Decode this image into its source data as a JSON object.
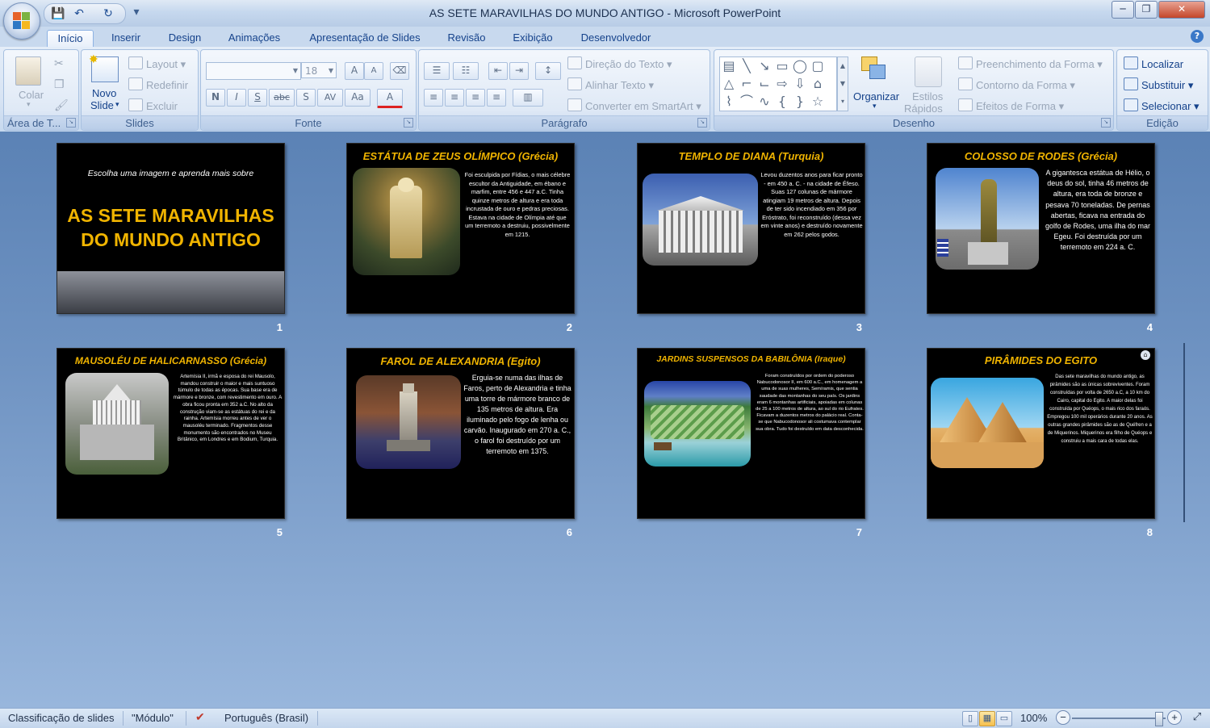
{
  "window": {
    "title": "AS SETE MARAVILHAS DO MUNDO ANTIGO - Microsoft PowerPoint",
    "minimize": "─",
    "maximize": "❐",
    "close": "✕"
  },
  "quick_access": {
    "save_icon": "save-icon",
    "undo_icon": "undo-icon",
    "redo_icon": "redo-icon",
    "customize_icon": "customize-qat-icon"
  },
  "tabs": [
    {
      "label": "Início",
      "active": true
    },
    {
      "label": "Inserir"
    },
    {
      "label": "Design"
    },
    {
      "label": "Animações"
    },
    {
      "label": "Apresentação de Slides"
    },
    {
      "label": "Revisão"
    },
    {
      "label": "Exibição"
    },
    {
      "label": "Desenvolvedor"
    }
  ],
  "ribbon": {
    "clipboard": {
      "label": "Área de T...",
      "paste": "Colar"
    },
    "slides": {
      "label": "Slides",
      "new_slide_1": "Novo",
      "new_slide_2": "Slide",
      "layout": "Layout",
      "reset": "Redefinir",
      "delete": "Excluir"
    },
    "font": {
      "label": "Fonte",
      "font_name": "",
      "font_size": "18",
      "bold": "N",
      "italic": "I",
      "underline": "S",
      "strike": "abc",
      "shadow": "S",
      "spacing": "AV",
      "case": "Aa",
      "color": "A",
      "grow": "A",
      "shrink": "A"
    },
    "paragraph": {
      "label": "Parágrafo",
      "text_direction": "Direção do Texto",
      "align_text": "Alinhar Texto",
      "smartart": "Converter em SmartArt"
    },
    "drawing": {
      "label": "Desenho",
      "arrange": "Organizar",
      "quick_styles_1": "Estilos",
      "quick_styles_2": "Rápidos",
      "fill": "Preenchimento da Forma",
      "outline": "Contorno da Forma",
      "effects": "Efeitos de Forma"
    },
    "editing": {
      "label": "Edição",
      "find": "Localizar",
      "replace": "Substituir",
      "select": "Selecionar"
    }
  },
  "slides": [
    {
      "number": "1",
      "subtitle": "Escolha uma imagem e aprenda mais sobre",
      "title_line1": "AS SETE MARAVILHAS",
      "title_line2": "DO MUNDO ANTIGO"
    },
    {
      "number": "2",
      "title": "ESTÁTUA  DE ZEUS OLÍMPICO (Grécia)",
      "body": "Foi esculpida por Fídias, o mais célebre escultor da Antiguidade, em ébano e marfim, entre 456 e 447 a.C. Tinha quinze metros de altura e era toda incrustada de ouro e pedras preciosas. Estava na cidade de Olímpia até que um terremoto a destruiu, possivelmente em 1215."
    },
    {
      "number": "3",
      "title": "TEMPLO DE DIANA (Turquia)",
      "body": "Levou duzentos anos para ficar pronto - em 450 a. C. - na cidade de Éfeso. Suas 127 colunas de mármore atingiam 19 metros de altura. Depois de ter sido incendiado em 356 por Eróstrato, foi reconstruído (dessa vez em vinte anos) e destruído novamente em 262 pelos godos."
    },
    {
      "number": "4",
      "title": "COLOSSO DE RODES (Grécia)",
      "body": "A gigantesca estátua de Hélio, o deus do sol, tinha 46 metros de altura, era toda de bronze e pesava 70 toneladas. De pernas abertas, ficava na entrada do golfo de Rodes, uma ilha do mar Egeu.  Foi destruída por um terremoto em 224 a. C."
    },
    {
      "number": "5",
      "title": "MAUSOLÉU DE HALICARNASSO (Grécia)",
      "body": "Artemísia II, irmã e esposa do rei Mausolo, mandou construir o maior e mais suntuoso túmulo de todas as épocas. Sua base era de mármore e bronze, com revestimento em ouro. A obra ficou pronta em 352 a.C. No alto da construção viam-se as estátuas do rei e da rainha. Artemísia morreu antes de ver o mausoléu terminado. Fragmentos desse monumento são encontrados no Museu Britânico, em Londres e em Bodium, Turquia."
    },
    {
      "number": "6",
      "title": "FAROL DE ALEXANDRIA (Egito)",
      "body": "Erguia-se numa das ilhas de Faros, perto de Alexandria e tinha uma torre de mármore branco de 135 metros de altura. Era iluminado pelo fogo de lenha ou carvão. Inaugurado em 270 a. C., o farol foi destruído  por um terremoto em 1375."
    },
    {
      "number": "7",
      "title": "JARDINS SUSPENSOS DA BABILÔNIA (Iraque)",
      "body": "Foram construídos por ordem do poderoso Nabucodonosor II, em 600 a.C., em homenagem a uma de suas mulheres, Semíramis, que sentia saudade das montanhas do seu país. Os jardins eram 6 montanhas artificiais, apoiadas em colunas de 25 a 100 metros de altura, ao sul do rio Eufrates. Ficavam a duzentos metros do palácio real. Conta-se que Nabucodonosor ali costumava contemplar sua obra. Tudo foi destruído em data desconhecida."
    },
    {
      "number": "8",
      "title": "PIRÂMIDES DO EGITO",
      "body": "Das sete maravilhas do mundo antigo, as pirâmides são as únicas sobreviventes. Foram construídas por volta de 2650 a.C, a 10 km do Cairo, capital do Egito.  A maior delas foi construída por Quéops, o mais rico dos faraós.  Empregou 100 mil operários durante 20 anos. As outras grandes pirâmides são as de Quéfren e a de Miquerinos. Miquerinos era filho de Quéops e construiu a mais cara de todas elas."
    }
  ],
  "statusbar": {
    "view": "Classificação de slides",
    "theme": "\"Módulo\"",
    "language": "Português (Brasil)",
    "zoom": "100%",
    "zoom_minus": "−",
    "zoom_plus": "+"
  }
}
